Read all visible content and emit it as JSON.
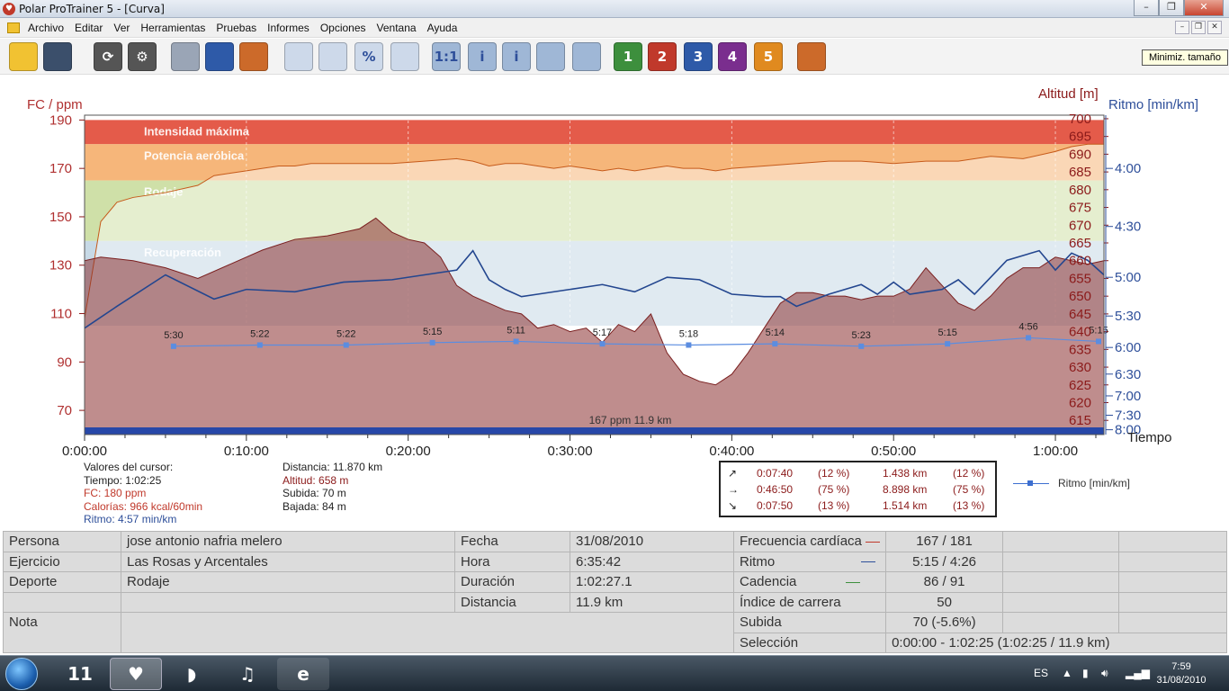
{
  "window": {
    "title": "Polar ProTrainer 5 - [Curva]",
    "minimize": "–",
    "maximize": "❐",
    "close": "✕"
  },
  "menu": [
    "Archivo",
    "Editar",
    "Ver",
    "Herramientas",
    "Pruebas",
    "Informes",
    "Opciones",
    "Ventana",
    "Ayuda"
  ],
  "mdi_controls": {
    "minimize": "–",
    "restore": "❐",
    "close": "✕"
  },
  "toolbar": {
    "tooltip": "Minimiz. tamaño",
    "buttons": [
      {
        "name": "open-folder-icon",
        "color": "#f1c232",
        "glyph": ""
      },
      {
        "name": "save-icon",
        "color": "#3b4f6b",
        "glyph": ""
      },
      {
        "name": "sync-icon",
        "color": "#555555",
        "glyph": "⟳"
      },
      {
        "name": "settings-icon",
        "color": "#555555",
        "glyph": "⚙"
      },
      {
        "name": "calendar-icon",
        "color": "#9aa5b6",
        "glyph": ""
      },
      {
        "name": "diary-icon",
        "color": "#2e5aa8",
        "glyph": ""
      },
      {
        "name": "user-icon",
        "color": "#cc6a2a",
        "glyph": ""
      },
      {
        "name": "curve-view-icon",
        "color": "#cdd9ea",
        "glyph": ""
      },
      {
        "name": "bar-view-icon",
        "color": "#cdd9ea",
        "glyph": ""
      },
      {
        "name": "percent-view-icon",
        "color": "#cdd9ea",
        "glyph": "%"
      },
      {
        "name": "table-view-icon",
        "color": "#cdd9ea",
        "glyph": ""
      },
      {
        "name": "zoom-icon",
        "color": "#9fb7d6",
        "glyph": "1:1"
      },
      {
        "name": "info-icon",
        "color": "#9fb7d6",
        "glyph": "i"
      },
      {
        "name": "info-rotate-icon",
        "color": "#9fb7d6",
        "glyph": "i"
      },
      {
        "name": "timer-icon",
        "color": "#9fb7d6",
        "glyph": ""
      },
      {
        "name": "multi-curve-icon",
        "color": "#9fb7d6",
        "glyph": ""
      },
      {
        "name": "zone-1-icon",
        "color": "#3d8f3d",
        "glyph": "1"
      },
      {
        "name": "zone-2-icon",
        "color": "#c0392b",
        "glyph": "2"
      },
      {
        "name": "zone-3-icon",
        "color": "#2e5aa8",
        "glyph": "3"
      },
      {
        "name": "zone-4-icon",
        "color": "#7a2e8e",
        "glyph": "4"
      },
      {
        "name": "zone-5-icon",
        "color": "#e08a1f",
        "glyph": "5"
      },
      {
        "name": "people-icon",
        "color": "#cc6a2a",
        "glyph": ""
      }
    ]
  },
  "chart_data": {
    "type": "line",
    "left_axis_label": "FC / ppm",
    "right_axis_label_altitude": "Altitud [m]",
    "right_axis_label_pace": "Ritmo [min/km]",
    "x_axis_label": "Tiempo",
    "x_range_seconds": [
      0,
      3780
    ],
    "hr_axis": {
      "min": 60,
      "max": 192,
      "ticks": [
        190,
        170,
        150,
        130,
        110,
        90,
        70
      ]
    },
    "altitude_axis": {
      "min": 611,
      "max": 701,
      "ticks": [
        700,
        695,
        690,
        685,
        680,
        675,
        670,
        665,
        660,
        655,
        650,
        645,
        640,
        635,
        630,
        625,
        620,
        615
      ]
    },
    "pace_axis": {
      "ticks": [
        "4:00",
        "4:30",
        "5:00",
        "5:30",
        "6:00",
        "6:30",
        "7:00",
        "7:30",
        "8:00"
      ],
      "tick_hr": [
        170,
        146,
        125,
        109,
        96,
        85,
        76,
        68,
        62
      ]
    },
    "x_ticks": [
      "0:00:00",
      "0:10:00",
      "0:20:00",
      "0:30:00",
      "0:40:00",
      "0:50:00",
      "1:00:00"
    ],
    "zones": [
      {
        "label": "Intensidad máxima",
        "from": 180,
        "to": 190,
        "color": "#e45b4a"
      },
      {
        "label": "Potencia aeróbica",
        "from": 165,
        "to": 180,
        "color": "#f6b67a"
      },
      {
        "label": "Rodaje",
        "from": 140,
        "to": 165,
        "color": "#cfe0a8"
      },
      {
        "label": "Recuperación",
        "from": 105,
        "to": 140,
        "color": "#c7d9e6"
      }
    ],
    "series": [
      {
        "name": "FC",
        "x": [
          0,
          60,
          120,
          180,
          300,
          420,
          480,
          540,
          600,
          660,
          720,
          780,
          840,
          900,
          1020,
          1140,
          1260,
          1380,
          1440,
          1500,
          1560,
          1620,
          1680,
          1740,
          1800,
          1860,
          1920,
          1980,
          2040,
          2100,
          2160,
          2220,
          2280,
          2340,
          2400,
          2520,
          2640,
          2760,
          2880,
          3000,
          3120,
          3240,
          3360,
          3480,
          3600,
          3660,
          3720,
          3780
        ],
        "y": [
          108,
          148,
          156,
          158,
          160,
          163,
          167,
          168,
          169,
          170,
          171,
          171,
          172,
          172,
          172,
          172,
          173,
          174,
          173,
          171,
          172,
          172,
          171,
          170,
          171,
          170,
          169,
          170,
          169,
          170,
          171,
          170,
          170,
          169,
          170,
          171,
          172,
          173,
          173,
          172,
          173,
          173,
          175,
          174,
          177,
          179,
          180,
          180
        ]
      },
      {
        "name": "Altitud",
        "x": [
          0,
          60,
          180,
          300,
          420,
          540,
          660,
          780,
          900,
          1020,
          1080,
          1140,
          1200,
          1260,
          1320,
          1380,
          1440,
          1500,
          1560,
          1620,
          1680,
          1740,
          1800,
          1860,
          1920,
          1980,
          2040,
          2100,
          2160,
          2220,
          2280,
          2340,
          2400,
          2460,
          2520,
          2580,
          2640,
          2700,
          2760,
          2820,
          2880,
          2940,
          3000,
          3060,
          3120,
          3180,
          3240,
          3300,
          3360,
          3420,
          3480,
          3540,
          3600,
          3660,
          3720,
          3780
        ],
        "y": [
          660,
          661,
          660,
          658,
          655,
          659,
          663,
          666,
          667,
          669,
          672,
          668,
          666,
          665,
          661,
          653,
          650,
          648,
          646,
          645,
          641,
          642,
          640,
          641,
          637,
          642,
          640,
          645,
          634,
          628,
          626,
          625,
          628,
          634,
          641,
          648,
          651,
          651,
          650,
          650,
          649,
          650,
          650,
          652,
          658,
          653,
          648,
          646,
          650,
          655,
          658,
          658,
          661,
          660,
          659,
          660
        ]
      },
      {
        "name": "Ritmo",
        "x": [
          0,
          120,
          300,
          480,
          600,
          780,
          960,
          1140,
          1260,
          1380,
          1440,
          1500,
          1560,
          1620,
          1680,
          1800,
          1920,
          2040,
          2160,
          2280,
          2400,
          2520,
          2580,
          2640,
          2760,
          2880,
          2940,
          3000,
          3060,
          3120,
          3180,
          3240,
          3300,
          3360,
          3420,
          3480,
          3540,
          3600,
          3660,
          3720,
          3780
        ],
        "y": [
          104,
          113,
          126,
          116,
          120,
          119,
          123,
          124,
          126,
          128,
          136,
          124,
          120,
          117,
          118,
          120,
          122,
          119,
          125,
          124,
          118,
          117,
          117,
          113,
          118,
          122,
          118,
          123,
          118,
          119,
          120,
          124,
          118,
          125,
          132,
          134,
          136,
          128,
          135,
          132,
          126
        ]
      },
      {
        "name": "Ritmo [min/km]",
        "x": [
          330,
          650,
          970,
          1290,
          1600,
          1920,
          2240,
          2560,
          2880,
          3200,
          3500,
          3760
        ],
        "y": [
          96.5,
          97,
          97,
          98,
          98.5,
          97.5,
          97,
          97.5,
          96.5,
          97.5,
          100,
          98.5
        ],
        "labels": [
          "5:30",
          "5:22",
          "5:22",
          "5:15",
          "5:11",
          "5:17",
          "5:18",
          "5:14",
          "5:23",
          "5:15",
          "4:56",
          "5:15"
        ]
      }
    ],
    "bottom_label": "167 ppm 11.9 km"
  },
  "cursor": {
    "title": "Valores del cursor:",
    "tiempo": "Tiempo: 1:02:25",
    "fc": "FC: 180 ppm",
    "calorias": "Calorías: 966 kcal/60min",
    "ritmo": "Ritmo: 4:57 min/km",
    "distancia": "Distancia: 11.870 km",
    "altitud": "Altitud: 658 m",
    "subida": "Subida: 70 m",
    "bajada": "Bajada: 84 m"
  },
  "slopes": [
    {
      "icon": "↗",
      "time": "0:07:40",
      "tpct": "(12 %)",
      "dist": "1.438 km",
      "dpct": "(12 %)"
    },
    {
      "icon": "→",
      "time": "0:46:50",
      "tpct": "(75 %)",
      "dist": "8.898 km",
      "dpct": "(75 %)"
    },
    {
      "icon": "↘",
      "time": "0:07:50",
      "tpct": "(13 %)",
      "dist": "1.514 km",
      "dpct": "(13 %)"
    }
  ],
  "legend_ritmo": "Ritmo [min/km]",
  "info": {
    "persona_label": "Persona",
    "persona": "jose antonio nafria melero",
    "ejercicio_label": "Ejercicio",
    "ejercicio": "Las Rosas y Arcentales",
    "deporte_label": "Deporte",
    "deporte": "Rodaje",
    "nota_label": "Nota",
    "fecha_label": "Fecha",
    "fecha": "31/08/2010",
    "hora_label": "Hora",
    "hora": "6:35:42",
    "duracion_label": "Duración",
    "duracion": "1:02:27.1",
    "distancia_label": "Distancia",
    "distancia": "11.9 km",
    "fc_label": "Frecuencia cardíaca",
    "fc": "167 / 181",
    "ritmo_label": "Ritmo",
    "ritmo": "5:15 / 4:26",
    "cadencia_label": "Cadencia",
    "cadencia": "86 / 91",
    "indice_label": "Índice de carrera",
    "indice": "50",
    "subida_label": "Subida",
    "subida": "70 (-5.6%)",
    "seleccion_label": "Selección",
    "seleccion": "0:00:00 - 1:02:25 (1:02:25 / 11.9 km)"
  },
  "taskbar": {
    "apps": [
      {
        "name": "app-11-icon",
        "glyph": "11",
        "color": "#d72b2b"
      },
      {
        "name": "polar-heart-icon",
        "glyph": "♥",
        "color": "#e0474c"
      },
      {
        "name": "polar-sync-icon",
        "glyph": "◗",
        "color": "#3a6fd0"
      },
      {
        "name": "itunes-icon",
        "glyph": "♫",
        "color": "#4aa3df"
      },
      {
        "name": "ie-icon",
        "glyph": "e",
        "color": "#2b7bd4"
      }
    ],
    "lang": "ES",
    "time": "7:59",
    "date": "31/08/2010"
  }
}
